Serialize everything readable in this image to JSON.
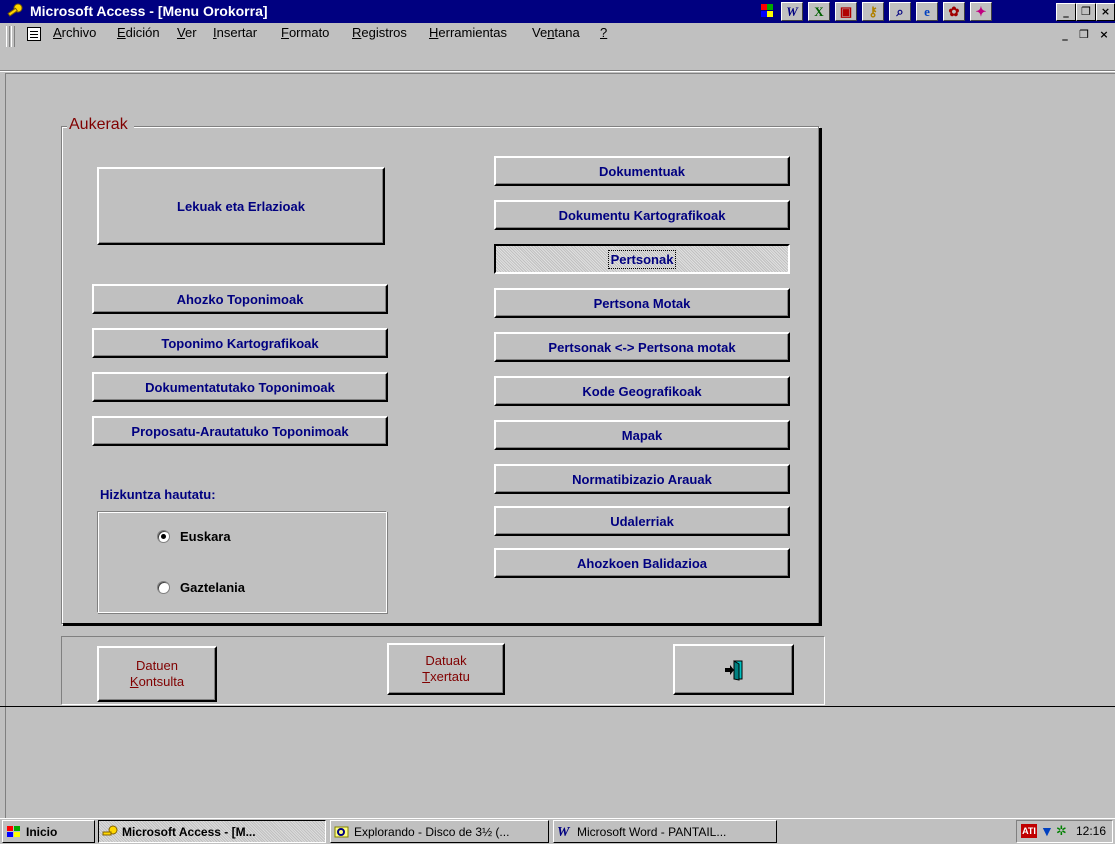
{
  "window": {
    "title": "Microsoft Access - [Menu Orokorra]"
  },
  "menu": {
    "items": [
      {
        "underline": "A",
        "rest": "rchivo"
      },
      {
        "underline": "E",
        "rest": "dición"
      },
      {
        "underline": "V",
        "rest": "er"
      },
      {
        "underline": "I",
        "rest": "nsertar"
      },
      {
        "underline": "F",
        "rest": "ormato"
      },
      {
        "underline": "R",
        "rest": "egistros"
      },
      {
        "underline": "H",
        "rest": "erramientas"
      },
      {
        "pre": "Ve",
        "underline": "n",
        "rest": "tana"
      },
      {
        "underline": "?",
        "rest": ""
      }
    ]
  },
  "form": {
    "group_label": "Aukerak",
    "left_buttons": {
      "big": "Lekuak eta Erlazioak",
      "ahozko": "Ahozko Toponimoak",
      "toponimo_kart": "Toponimo Kartografikoak",
      "dokumentatutako": "Dokumentatutako Toponimoak",
      "proposatu": "Proposatu-Arautatuko Toponimoak"
    },
    "right_buttons": {
      "dokumentuak": "Dokumentuak",
      "dok_kart": "Dokumentu Kartografikoak",
      "pertsonak": "Pertsonak",
      "pertsona_motak": "Pertsona Motak",
      "pertsonak_motak": "Pertsonak <-> Pertsona motak",
      "kode_geo": "Kode Geografikoak",
      "mapak": "Mapak",
      "normatibizazio": "Normatibizazio Arauak",
      "udalerriak": "Udalerriak",
      "ahozkoen": "Ahozkoen Balidazioa"
    },
    "language": {
      "label": "Hizkuntza hautatu:",
      "options": [
        "Euskara",
        "Gaztelania"
      ],
      "selected": "Euskara"
    }
  },
  "footer": {
    "consulta": {
      "line1": "Datuen",
      "line2_u": "K",
      "line2_rest": "ontsulta"
    },
    "txertatu": {
      "line1": "Datuak",
      "line2_u": "T",
      "line2_rest": "xertatu"
    },
    "exit_icon": "exit-door-icon"
  },
  "taskbar": {
    "start": "Inicio",
    "tasks": [
      "Microsoft Access - [M...",
      "Explorando - Disco de 3½ (...",
      "Microsoft Word - PANTAIL..."
    ],
    "clock": "12:16"
  }
}
